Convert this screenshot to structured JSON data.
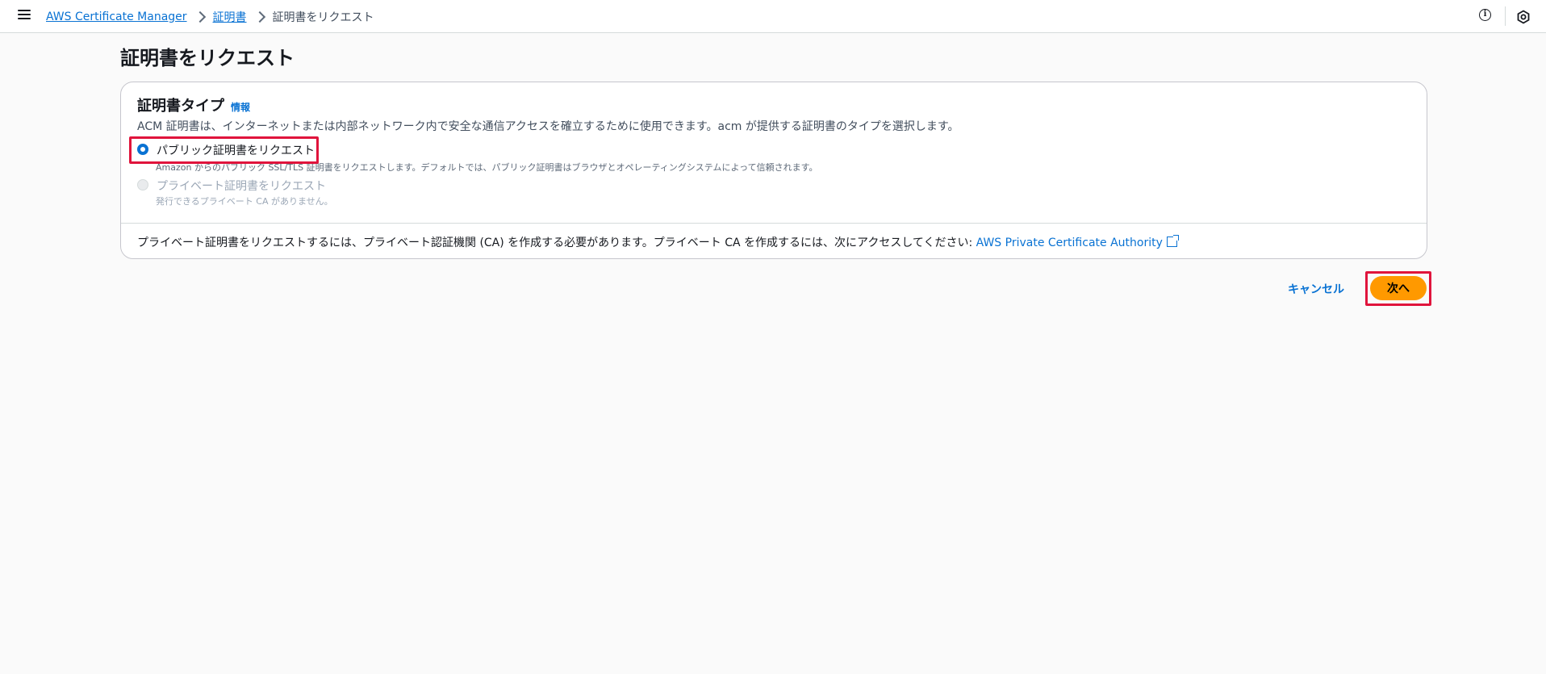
{
  "header": {
    "breadcrumbs": [
      {
        "label": "AWS Certificate Manager"
      },
      {
        "label": "証明書"
      },
      {
        "label": "証明書をリクエスト"
      }
    ],
    "info_icon_glyph": "i",
    "icons": [
      "menu-icon",
      "info-icon",
      "settings-icon"
    ]
  },
  "page": {
    "title": "証明書をリクエスト"
  },
  "panel": {
    "title": "証明書タイプ",
    "info_link": "情報",
    "description": "ACM 証明書は、インターネットまたは内部ネットワーク内で安全な通信アクセスを確立するために使用できます。acm が提供する証明書のタイプを選択します。",
    "options": [
      {
        "label": "パブリック証明書をリクエスト",
        "description": "Amazon からのパブリック SSL/TLS 証明書をリクエストします。デフォルトでは、パブリック証明書はブラウザとオペレーティングシステムによって信頼されます。",
        "selected": true,
        "disabled": false
      },
      {
        "label": "プライベート証明書をリクエスト",
        "description": "発行できるプライベート CA がありません。",
        "selected": false,
        "disabled": true
      }
    ],
    "footer_text": "プライベート証明書をリクエストするには、プライベート認証機関 (CA) を作成する必要があります。プライベート CA を作成するには、次にアクセスしてください: ",
    "footer_link": "AWS Private Certificate Authority"
  },
  "actions": {
    "cancel_label": "キャンセル",
    "next_label": "次へ"
  },
  "colors": {
    "primary_button": "#ff9900",
    "link": "#0972d3",
    "highlight": "#e0143c"
  }
}
